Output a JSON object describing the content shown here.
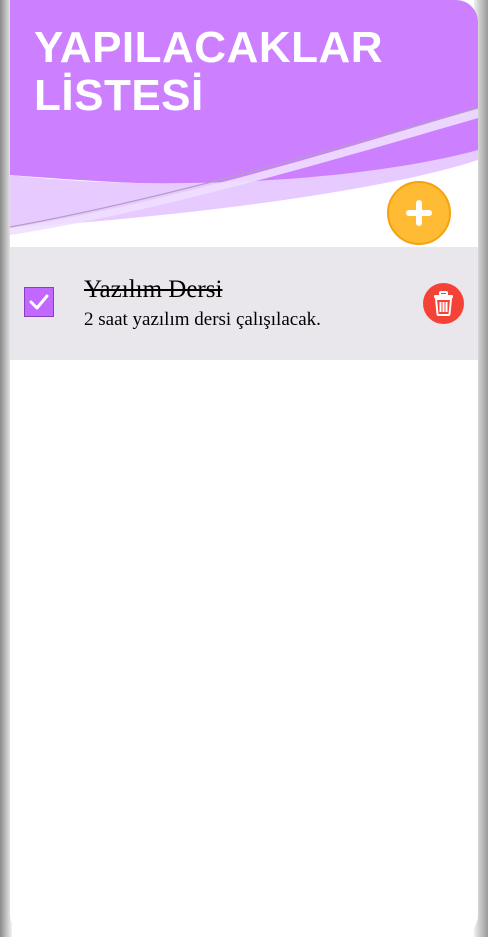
{
  "header": {
    "title": "YAPILACAKLAR LİSTESİ",
    "accent_color": "#cc80ff"
  },
  "add_button": {
    "icon": "plus-icon",
    "color": "#ffbb33"
  },
  "todos": [
    {
      "title": "Yazılım Dersi",
      "description": "2 saat yazılım dersi çalışılacak.",
      "completed": true,
      "checkbox_icon": "checkmark-icon",
      "delete_icon": "trash-icon"
    }
  ],
  "colors": {
    "item_background": "#e9e6ec",
    "checkbox": "#c068ff",
    "delete": "#f44336"
  }
}
